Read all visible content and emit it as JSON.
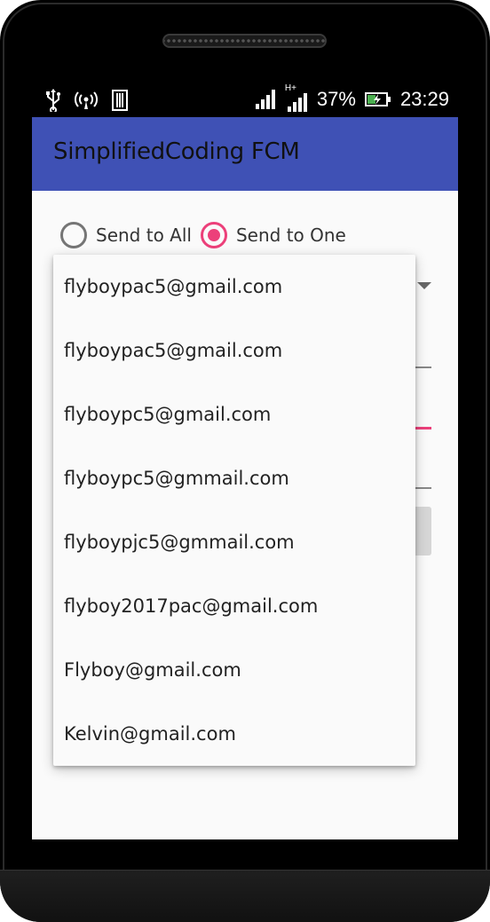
{
  "status_bar": {
    "battery": "37%",
    "time": "23:29",
    "network_type": "H+",
    "icons": [
      "usb-icon",
      "wireless-hotspot-icon",
      "sim-icon",
      "signal-icon",
      "signal-hplus-icon",
      "battery-charging-icon"
    ]
  },
  "toolbar": {
    "title": "SimplifiedCoding FCM",
    "color": "#3f51b5"
  },
  "radio_group": {
    "options": [
      {
        "label": "Send to All",
        "checked": false
      },
      {
        "label": "Send to One",
        "checked": true
      }
    ],
    "accent_color": "#ec407a"
  },
  "dropdown": {
    "items": [
      "flyboypac5@gmail.com",
      "flyboypac5@gmail.com",
      "flyboypc5@gmail.com",
      "flyboypc5@gmmail.com",
      "flyboypjc5@gmmail.com",
      "flyboy2017pac@gmail.com",
      "Flyboy@gmail.com",
      "Kelvin@gmail.com"
    ]
  }
}
